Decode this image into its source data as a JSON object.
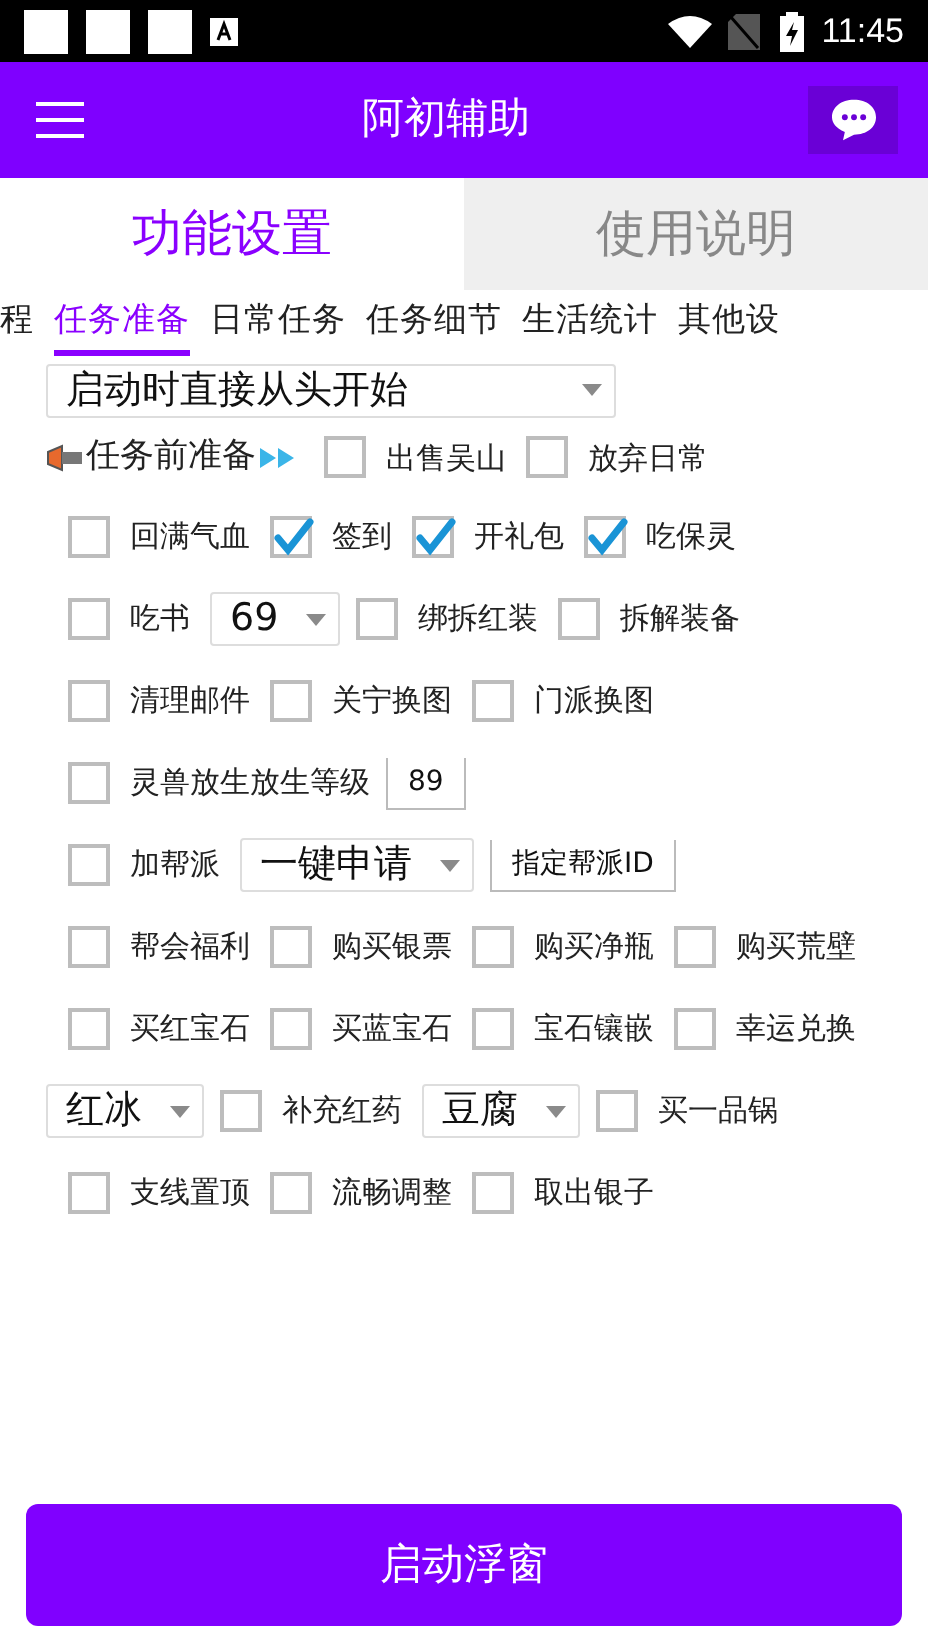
{
  "status_bar": {
    "time": "11:45"
  },
  "app_bar": {
    "title": "阿初辅助"
  },
  "tabs": [
    {
      "label": "功能设置",
      "selected": true
    },
    {
      "label": "使用说明",
      "selected": false
    }
  ],
  "sub_tabs": [
    {
      "label": "程",
      "selected": false
    },
    {
      "label": "任务准备",
      "selected": true
    },
    {
      "label": "日常任务",
      "selected": false
    },
    {
      "label": "任务细节",
      "selected": false
    },
    {
      "label": "生活统计",
      "selected": false
    },
    {
      "label": "其他设",
      "selected": false
    }
  ],
  "rows": [
    {
      "items": [
        {
          "kind": "select",
          "value": "启动时直接从头开始"
        }
      ]
    },
    {
      "items": [
        {
          "kind": "heading",
          "label": "任务前准备"
        },
        {
          "kind": "checkbox",
          "label": "出售吴山",
          "checked": false
        },
        {
          "kind": "checkbox",
          "label": "放弃日常",
          "checked": false
        }
      ]
    },
    {
      "items": [
        {
          "kind": "checkbox",
          "label": "回满气血",
          "checked": false
        },
        {
          "kind": "checkbox",
          "label": "签到",
          "checked": true
        },
        {
          "kind": "checkbox",
          "label": "开礼包",
          "checked": true
        },
        {
          "kind": "checkbox",
          "label": "吃保灵",
          "checked": true
        }
      ]
    },
    {
      "items": [
        {
          "kind": "checkbox",
          "label": "吃书",
          "checked": false
        },
        {
          "kind": "select",
          "value": "69"
        },
        {
          "kind": "checkbox",
          "label": "绑拆红装",
          "checked": false
        },
        {
          "kind": "checkbox",
          "label": "拆解装备",
          "checked": false
        }
      ]
    },
    {
      "items": [
        {
          "kind": "checkbox",
          "label": "清理邮件",
          "checked": false
        },
        {
          "kind": "checkbox",
          "label": "关宁换图",
          "checked": false
        },
        {
          "kind": "checkbox",
          "label": "门派换图",
          "checked": false
        }
      ]
    },
    {
      "items": [
        {
          "kind": "checkbox",
          "label": "灵兽放生放生等级",
          "checked": false
        },
        {
          "kind": "input",
          "value": "89"
        }
      ]
    },
    {
      "items": [
        {
          "kind": "checkbox",
          "label": "加帮派",
          "checked": false
        },
        {
          "kind": "select",
          "value": "一键申请"
        },
        {
          "kind": "button",
          "label": "指定帮派ID"
        }
      ]
    },
    {
      "items": [
        {
          "kind": "checkbox",
          "label": "帮会福利",
          "checked": false
        },
        {
          "kind": "checkbox",
          "label": "购买银票",
          "checked": false
        },
        {
          "kind": "checkbox",
          "label": "购买净瓶",
          "checked": false
        },
        {
          "kind": "checkbox",
          "label": "购买荒壁",
          "checked": false
        }
      ]
    },
    {
      "items": [
        {
          "kind": "checkbox",
          "label": "买红宝石",
          "checked": false
        },
        {
          "kind": "checkbox",
          "label": "买蓝宝石",
          "checked": false
        },
        {
          "kind": "checkbox",
          "label": "宝石镶嵌",
          "checked": false
        },
        {
          "kind": "checkbox",
          "label": "幸运兑换",
          "checked": false
        }
      ]
    },
    {
      "items": [
        {
          "kind": "select",
          "value": "红冰"
        },
        {
          "kind": "checkbox",
          "label": "补充红药",
          "checked": false
        },
        {
          "kind": "select",
          "value": "豆腐"
        },
        {
          "kind": "checkbox",
          "label": "买一品锅",
          "checked": false
        }
      ]
    },
    {
      "items": [
        {
          "kind": "checkbox",
          "label": "支线置顶",
          "checked": false
        },
        {
          "kind": "checkbox",
          "label": "流畅调整",
          "checked": false
        },
        {
          "kind": "checkbox",
          "label": "取出银子",
          "checked": false
        }
      ]
    }
  ],
  "start_button": {
    "label": "启动浮窗"
  }
}
